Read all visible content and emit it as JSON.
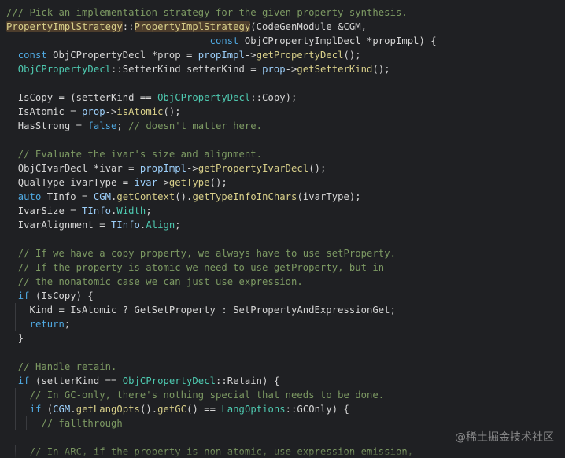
{
  "colors": {
    "background": "#1f2023",
    "comment": "#7d9a63",
    "keyword": "#4fa8e0",
    "type": "#4ec9b0",
    "function": "#d9d08a",
    "variable": "#9ccffa",
    "plain": "#d6d6d6",
    "highlight_bg": "#4d3d2c"
  },
  "code": {
    "lines": [
      {
        "tokens": [
          {
            "t": "/// Pick an implementation strategy for the given property synthesis.",
            "k": "comment"
          }
        ]
      },
      {
        "tokens": [
          {
            "t": "PropertyImplStrategy",
            "k": "hl"
          },
          {
            "t": "::",
            "k": "plain"
          },
          {
            "t": "PropertyImplStrategy",
            "k": "hl"
          },
          {
            "t": "(CodeGenModule &CGM,",
            "k": "plain"
          }
        ]
      },
      {
        "tokens": [
          {
            "t": "                                   ",
            "k": "plain"
          },
          {
            "t": "const",
            "k": "kw"
          },
          {
            "t": " ObjCPropertyImplDecl *propImpl) {",
            "k": "plain"
          }
        ]
      },
      {
        "tokens": [
          {
            "t": "  ",
            "k": "plain"
          },
          {
            "t": "const",
            "k": "kw"
          },
          {
            "t": " ObjCPropertyDecl *prop = ",
            "k": "plain"
          },
          {
            "t": "propImpl",
            "k": "var"
          },
          {
            "t": "->",
            "k": "plain"
          },
          {
            "t": "getPropertyDecl",
            "k": "fn"
          },
          {
            "t": "();",
            "k": "plain"
          }
        ]
      },
      {
        "tokens": [
          {
            "t": "  ",
            "k": "plain"
          },
          {
            "t": "ObjCPropertyDecl",
            "k": "type"
          },
          {
            "t": "::SetterKind setterKind = ",
            "k": "plain"
          },
          {
            "t": "prop",
            "k": "var"
          },
          {
            "t": "->",
            "k": "plain"
          },
          {
            "t": "getSetterKind",
            "k": "fn"
          },
          {
            "t": "();",
            "k": "plain"
          }
        ]
      },
      {
        "tokens": []
      },
      {
        "tokens": [
          {
            "t": "  IsCopy = (setterKind == ",
            "k": "plain"
          },
          {
            "t": "ObjCPropertyDecl",
            "k": "type"
          },
          {
            "t": "::Copy);",
            "k": "plain"
          }
        ]
      },
      {
        "tokens": [
          {
            "t": "  IsAtomic = ",
            "k": "plain"
          },
          {
            "t": "prop",
            "k": "var"
          },
          {
            "t": "->",
            "k": "plain"
          },
          {
            "t": "isAtomic",
            "k": "fn"
          },
          {
            "t": "();",
            "k": "plain"
          }
        ]
      },
      {
        "tokens": [
          {
            "t": "  HasStrong = ",
            "k": "plain"
          },
          {
            "t": "false",
            "k": "kw"
          },
          {
            "t": "; ",
            "k": "plain"
          },
          {
            "t": "// doesn't matter here.",
            "k": "comment"
          }
        ]
      },
      {
        "tokens": []
      },
      {
        "tokens": [
          {
            "t": "  ",
            "k": "plain"
          },
          {
            "t": "// Evaluate the ivar's size and alignment.",
            "k": "comment"
          }
        ]
      },
      {
        "tokens": [
          {
            "t": "  ObjCIvarDecl *ivar = ",
            "k": "plain"
          },
          {
            "t": "propImpl",
            "k": "var"
          },
          {
            "t": "->",
            "k": "plain"
          },
          {
            "t": "getPropertyIvarDecl",
            "k": "fn"
          },
          {
            "t": "();",
            "k": "plain"
          }
        ]
      },
      {
        "tokens": [
          {
            "t": "  QualType ivarType = ",
            "k": "plain"
          },
          {
            "t": "ivar",
            "k": "var"
          },
          {
            "t": "->",
            "k": "plain"
          },
          {
            "t": "getType",
            "k": "fn"
          },
          {
            "t": "();",
            "k": "plain"
          }
        ]
      },
      {
        "tokens": [
          {
            "t": "  ",
            "k": "plain"
          },
          {
            "t": "auto",
            "k": "kw"
          },
          {
            "t": " TInfo = ",
            "k": "plain"
          },
          {
            "t": "CGM",
            "k": "var"
          },
          {
            "t": ".",
            "k": "plain"
          },
          {
            "t": "getContext",
            "k": "fn"
          },
          {
            "t": "().",
            "k": "plain"
          },
          {
            "t": "getTypeInfoInChars",
            "k": "fn"
          },
          {
            "t": "(ivarType);",
            "k": "plain"
          }
        ]
      },
      {
        "tokens": [
          {
            "t": "  IvarSize = ",
            "k": "plain"
          },
          {
            "t": "TInfo",
            "k": "var"
          },
          {
            "t": ".",
            "k": "plain"
          },
          {
            "t": "Width",
            "k": "type"
          },
          {
            "t": ";",
            "k": "plain"
          }
        ]
      },
      {
        "tokens": [
          {
            "t": "  IvarAlignment = ",
            "k": "plain"
          },
          {
            "t": "TInfo",
            "k": "var"
          },
          {
            "t": ".",
            "k": "plain"
          },
          {
            "t": "Align",
            "k": "type"
          },
          {
            "t": ";",
            "k": "plain"
          }
        ]
      },
      {
        "tokens": []
      },
      {
        "tokens": [
          {
            "t": "  ",
            "k": "plain"
          },
          {
            "t": "// If we have a copy property, we always have to use setProperty.",
            "k": "comment"
          }
        ]
      },
      {
        "tokens": [
          {
            "t": "  ",
            "k": "plain"
          },
          {
            "t": "// If the property is atomic we need to use getProperty, but in",
            "k": "comment"
          }
        ]
      },
      {
        "tokens": [
          {
            "t": "  ",
            "k": "plain"
          },
          {
            "t": "// the nonatomic case we can just use expression.",
            "k": "comment"
          }
        ]
      },
      {
        "tokens": [
          {
            "t": "  ",
            "k": "plain"
          },
          {
            "t": "if",
            "k": "kw"
          },
          {
            "t": " (IsCopy) {",
            "k": "plain"
          }
        ]
      },
      {
        "tokens": [
          {
            "t": "    Kind = IsAtomic ? GetSetProperty : SetPropertyAndExpressionGet;",
            "k": "plain"
          }
        ],
        "guides": [
          1
        ]
      },
      {
        "tokens": [
          {
            "t": "    ",
            "k": "plain"
          },
          {
            "t": "return",
            "k": "kw"
          },
          {
            "t": ";",
            "k": "plain"
          }
        ],
        "guides": [
          1
        ]
      },
      {
        "tokens": [
          {
            "t": "  }",
            "k": "plain"
          }
        ]
      },
      {
        "tokens": []
      },
      {
        "tokens": [
          {
            "t": "  ",
            "k": "plain"
          },
          {
            "t": "// Handle retain.",
            "k": "comment"
          }
        ]
      },
      {
        "tokens": [
          {
            "t": "  ",
            "k": "plain"
          },
          {
            "t": "if",
            "k": "kw"
          },
          {
            "t": " (setterKind == ",
            "k": "plain"
          },
          {
            "t": "ObjCPropertyDecl",
            "k": "type"
          },
          {
            "t": "::Retain) {",
            "k": "plain"
          }
        ]
      },
      {
        "tokens": [
          {
            "t": "    ",
            "k": "plain"
          },
          {
            "t": "// In GC-only, there's nothing special that needs to be done.",
            "k": "comment"
          }
        ],
        "guides": [
          1
        ]
      },
      {
        "tokens": [
          {
            "t": "    ",
            "k": "plain"
          },
          {
            "t": "if",
            "k": "kw"
          },
          {
            "t": " (",
            "k": "plain"
          },
          {
            "t": "CGM",
            "k": "var"
          },
          {
            "t": ".",
            "k": "plain"
          },
          {
            "t": "getLangOpts",
            "k": "fn"
          },
          {
            "t": "().",
            "k": "plain"
          },
          {
            "t": "getGC",
            "k": "fn"
          },
          {
            "t": "() == ",
            "k": "plain"
          },
          {
            "t": "LangOptions",
            "k": "type"
          },
          {
            "t": "::GCOnly) {",
            "k": "plain"
          }
        ],
        "guides": [
          1
        ]
      },
      {
        "tokens": [
          {
            "t": "      ",
            "k": "plain"
          },
          {
            "t": "// fallthrough",
            "k": "comment"
          }
        ],
        "guides": [
          1,
          2
        ]
      },
      {
        "tokens": []
      },
      {
        "tokens": [
          {
            "t": "    ",
            "k": "plain"
          },
          {
            "t": "// In ARC, if the property is non-atomic, use expression emission,",
            "k": "comment"
          }
        ],
        "guides": [
          1
        ]
      }
    ]
  },
  "watermark": "@稀土掘金技术社区"
}
